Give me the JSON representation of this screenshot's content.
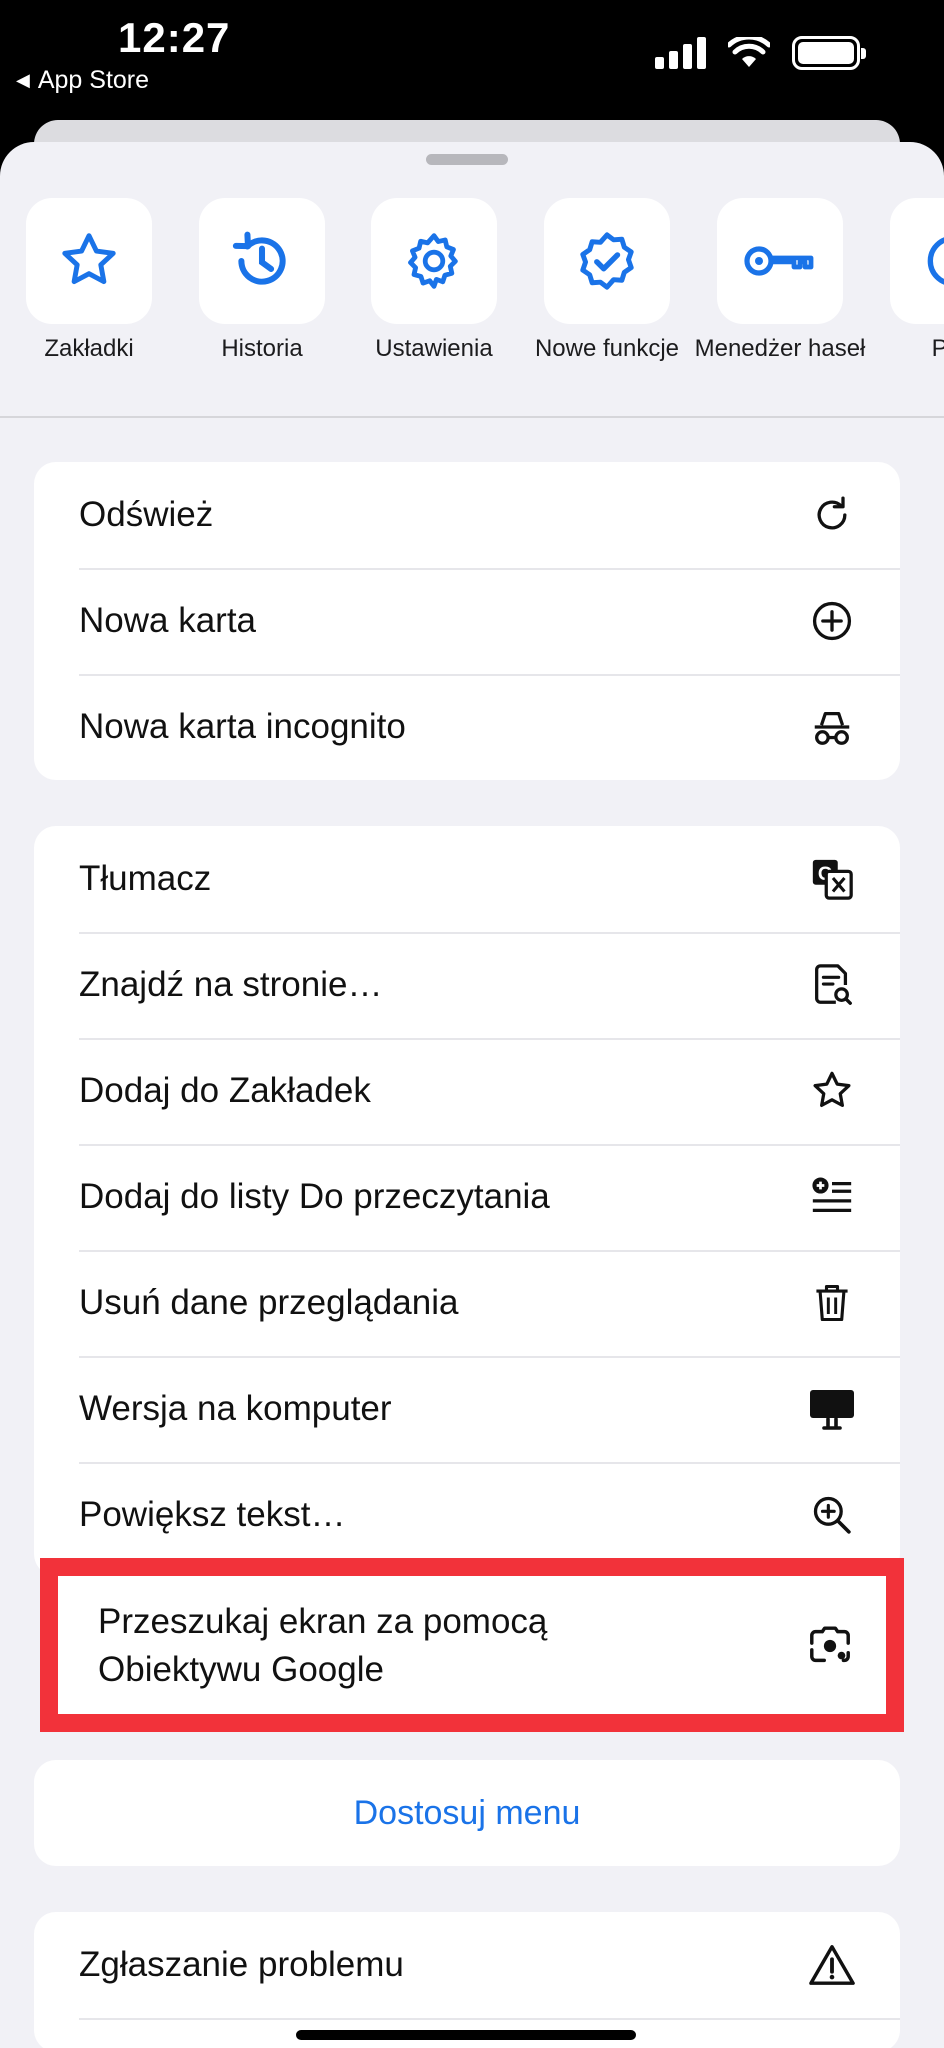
{
  "status_bar": {
    "time": "12:27",
    "back_label": "App Store"
  },
  "shortcuts": [
    {
      "label": "Zakładki",
      "icon": "star-icon"
    },
    {
      "label": "Historia",
      "icon": "history-icon"
    },
    {
      "label": "Ustawienia",
      "icon": "gear-icon"
    },
    {
      "label": "Nowe funkcje",
      "icon": "verified-badge-icon"
    },
    {
      "label": "Menedżer haseł",
      "icon": "key-icon"
    },
    {
      "label": "Pob",
      "icon": "download-icon"
    }
  ],
  "menu_group_1": [
    {
      "label": "Odśwież",
      "icon": "refresh-icon"
    },
    {
      "label": "Nowa karta",
      "icon": "plus-circle-icon"
    },
    {
      "label": "Nowa karta incognito",
      "icon": "incognito-icon"
    }
  ],
  "menu_group_2": [
    {
      "label": "Tłumacz",
      "icon": "translate-icon"
    },
    {
      "label": "Znajdź na stronie…",
      "icon": "find-in-page-icon"
    },
    {
      "label": "Dodaj do Zakładek",
      "icon": "star-outline-icon"
    },
    {
      "label": "Dodaj do listy Do przeczytania",
      "icon": "reading-list-icon"
    },
    {
      "label": "Usuń dane przeglądania",
      "icon": "trash-icon"
    },
    {
      "label": "Wersja na komputer",
      "icon": "desktop-icon"
    },
    {
      "label": "Powiększ tekst…",
      "icon": "zoom-in-icon"
    }
  ],
  "lens_item": {
    "line1": "Przeszukaj ekran za pomocą",
    "line2": "Obiektywu Google",
    "icon": "google-lens-icon"
  },
  "customize_button": "Dostosuj menu",
  "menu_group_3": [
    {
      "label": "Zgłaszanie problemu",
      "icon": "warning-icon"
    }
  ],
  "colors": {
    "accent": "#1a73e8",
    "highlight_border": "#f2323a",
    "sheet_bg": "#f1f1f6"
  }
}
